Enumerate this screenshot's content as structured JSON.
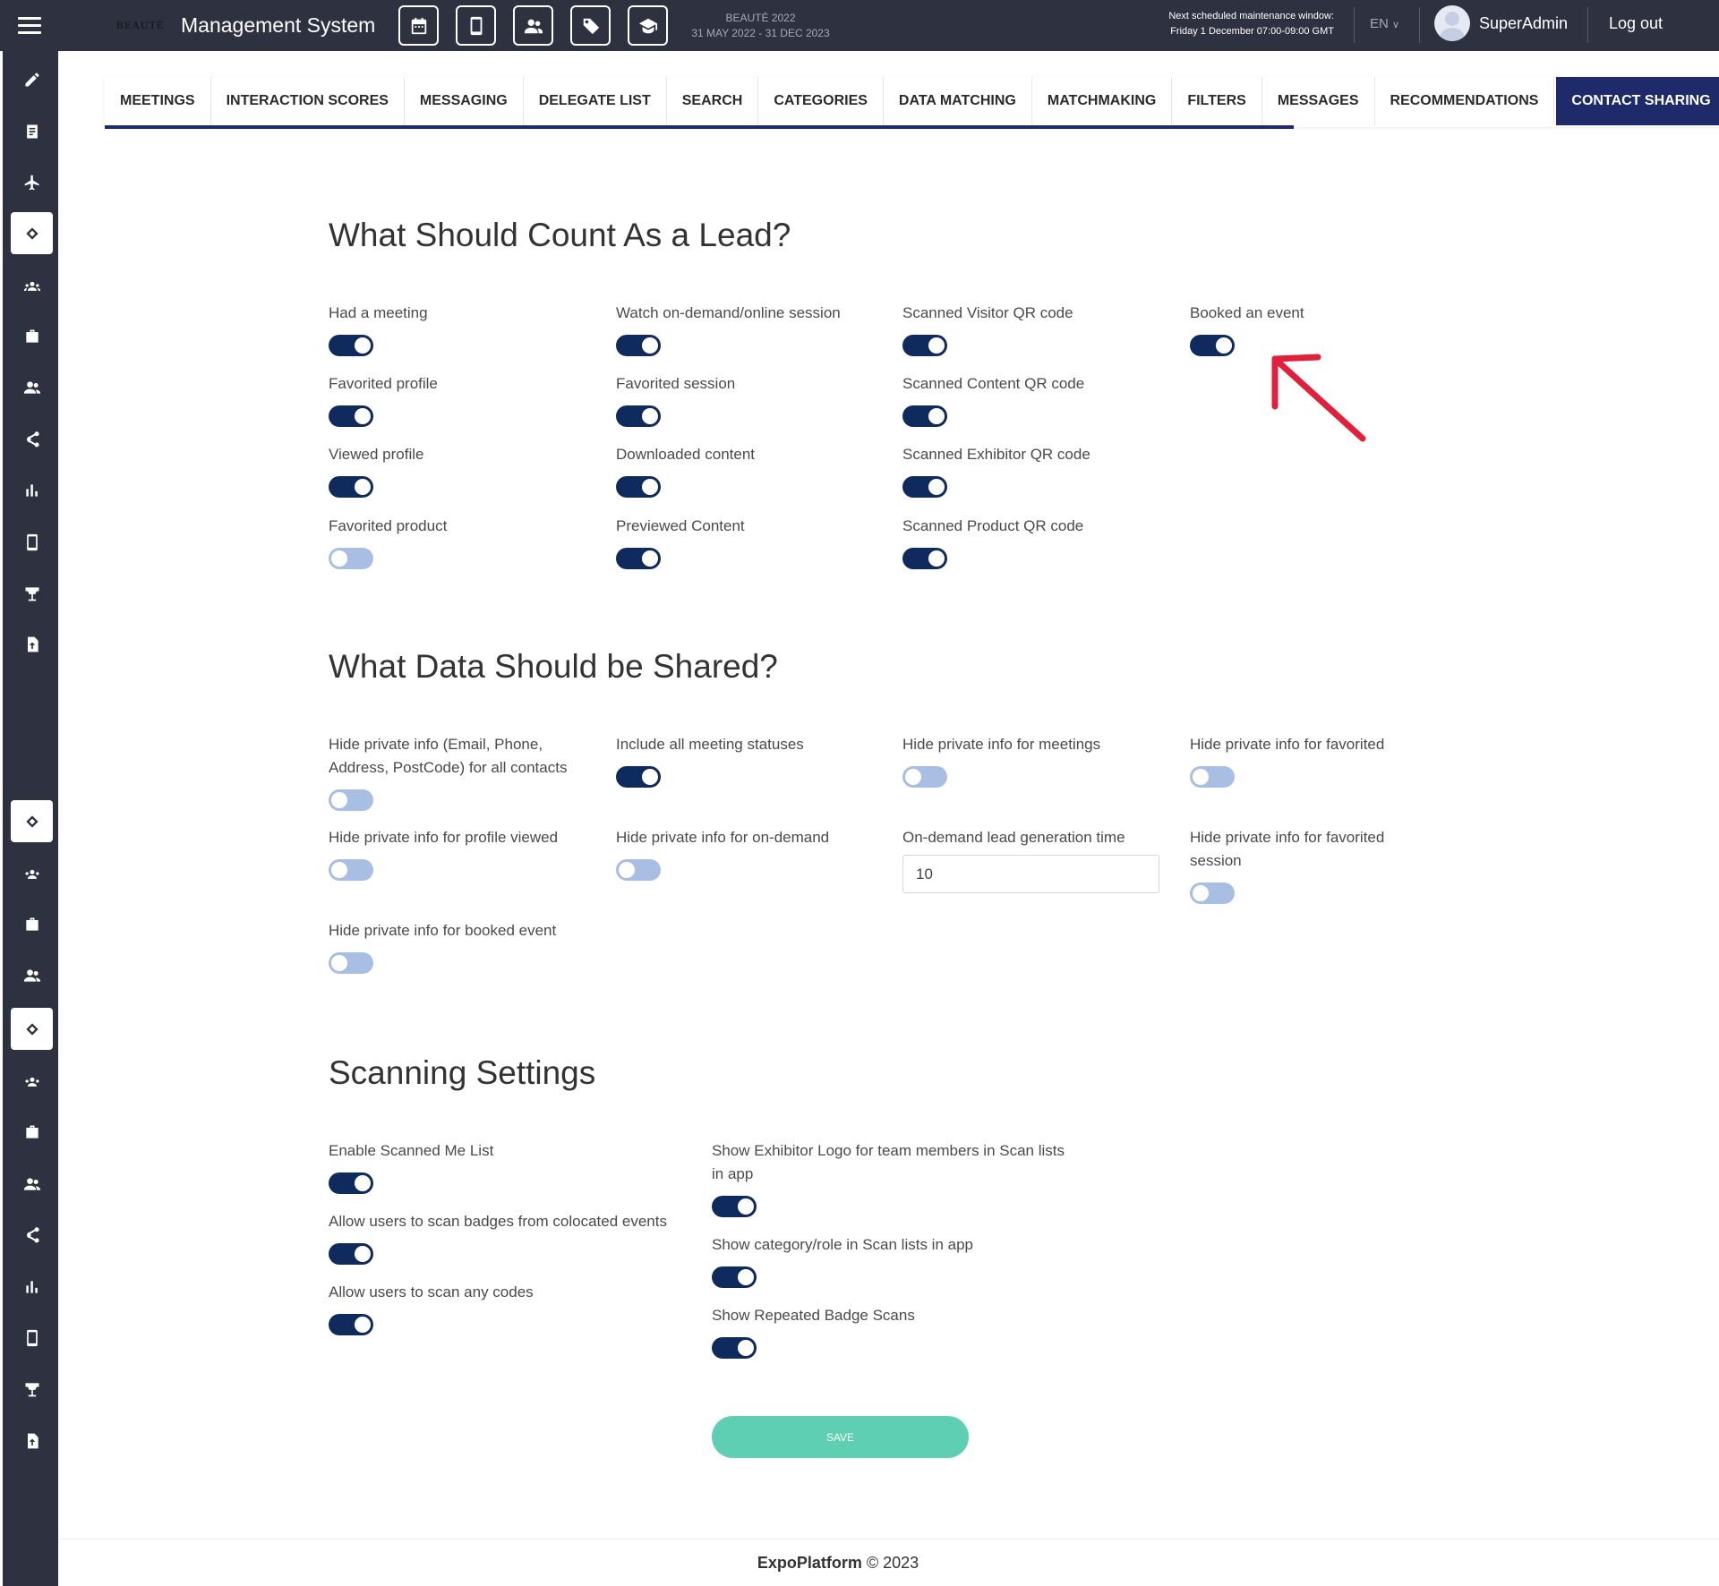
{
  "header": {
    "logo_text": "BEAUTÉ",
    "app_title": "Management System",
    "event_name": "BEAUTÉ 2022",
    "event_dates": "31 MAY 2022 - 31 DEC 2023",
    "maintenance_title": "Next scheduled maintenance window:",
    "maintenance_time": "Friday 1 December 07:00-09:00 GMT",
    "language": "EN",
    "user_name": "SuperAdmin",
    "logout_label": "Log out",
    "icons": [
      "calendar-icon",
      "mobile-icon",
      "users-icon",
      "tag-icon",
      "graduation-cap-icon"
    ]
  },
  "tabs": [
    {
      "label": "MEETINGS",
      "active": false
    },
    {
      "label": "INTERACTION SCORES",
      "active": false
    },
    {
      "label": "MESSAGING",
      "active": false
    },
    {
      "label": "DELEGATE LIST",
      "active": false
    },
    {
      "label": "SEARCH",
      "active": false
    },
    {
      "label": "CATEGORIES",
      "active": false
    },
    {
      "label": "DATA MATCHING",
      "active": false
    },
    {
      "label": "MATCHMAKING",
      "active": false
    },
    {
      "label": "FILTERS",
      "active": false
    },
    {
      "label": "MESSAGES",
      "active": false
    },
    {
      "label": "RECOMMENDATIONS",
      "active": false
    },
    {
      "label": "CONTACT SHARING",
      "active": true
    }
  ],
  "lead_section": {
    "title": "What Should Count As a Lead?",
    "fields": [
      {
        "label": "Had a meeting",
        "on": true
      },
      {
        "label": "Watch on-demand/online session",
        "on": true
      },
      {
        "label": "Scanned Visitor QR code",
        "on": true
      },
      {
        "label": "Booked an event",
        "on": true
      },
      {
        "label": "Favorited profile",
        "on": true
      },
      {
        "label": "Favorited session",
        "on": true
      },
      {
        "label": "Scanned Content QR code",
        "on": true
      },
      {
        "label": "Viewed profile",
        "on": true
      },
      {
        "label": "Downloaded content",
        "on": true
      },
      {
        "label": "Scanned Exhibitor QR code",
        "on": true
      },
      {
        "label": "Favorited product",
        "on": false
      },
      {
        "label": "Previewed Content",
        "on": true
      },
      {
        "label": "Scanned Product QR code",
        "on": true
      }
    ]
  },
  "data_section": {
    "title": "What Data Should be Shared?",
    "fields": [
      {
        "label": "Hide private info (Email, Phone, Address, PostCode) for all contacts",
        "on": false
      },
      {
        "label": "Include all meeting statuses",
        "on": true
      },
      {
        "label": "Hide private info for meetings",
        "on": false
      },
      {
        "label": "Hide private info for favorited",
        "on": false
      },
      {
        "label": "Hide private info for profile viewed",
        "on": false
      },
      {
        "label": "Hide private info for on-demand",
        "on": false
      },
      {
        "label": "On-demand lead generation time",
        "value": "10"
      },
      {
        "label": "Hide private info for favorited session",
        "on": false
      },
      {
        "label": "Hide private info for booked event",
        "on": false
      }
    ]
  },
  "scan_section": {
    "title": "Scanning Settings",
    "fields": [
      {
        "label": "Enable Scanned Me List",
        "on": true
      },
      {
        "label": "Allow users to scan badges from colocated events",
        "on": true
      },
      {
        "label": "Allow users to scan any codes",
        "on": true
      },
      {
        "label": "Show Exhibitor Logo for team members in Scan lists in app",
        "on": true
      },
      {
        "label": "Show category/role in Scan lists in app",
        "on": true
      },
      {
        "label": "Show Repeated Badge Scans",
        "on": true
      }
    ]
  },
  "save_label": "SAVE",
  "footer": {
    "brand": "ExpoPlatform",
    "copyright": "© 2023"
  },
  "colors": {
    "toggle_on": "#0f2a5c",
    "toggle_off": "#a9bee3",
    "active_tab": "#1f2a6b",
    "save_button": "#5ecfb2",
    "topbar": "#2e3140"
  }
}
